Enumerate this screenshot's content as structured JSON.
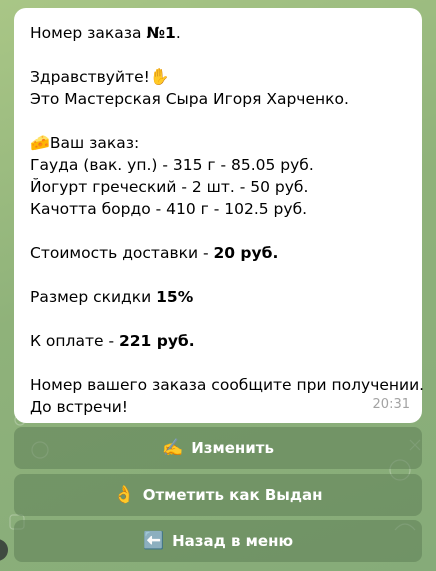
{
  "message": {
    "order_prefix": "Номер заказа ",
    "order_number": "№1",
    "order_suffix": ".",
    "greeting": "Здравствуйте!",
    "greeting_icon": "raised-hand",
    "intro": "Это Мастерская Сыра Игоря Харченко.",
    "order_header_icon": "cheese",
    "order_header": "Ваш заказ:",
    "items": [
      "Гауда (вак. уп.) - 315 г - 85.05 руб.",
      "Йогурт греческий - 2 шт. - 50 руб.",
      "Качотта бордо - 410 г - 102.5 руб."
    ],
    "delivery_label": "Стоимость доставки - ",
    "delivery_value": "20 руб.",
    "discount_label": "Размер скидки ",
    "discount_value": "15%",
    "total_label": "К оплате - ",
    "total_value": "221 руб.",
    "footer_line1": "Номер вашего заказа сообщите при получении.",
    "footer_line2": "До встречи!",
    "time": "20:31"
  },
  "keyboard": {
    "buttons": [
      {
        "icon": "writing-hand",
        "label": "Изменить"
      },
      {
        "icon": "ok-hand",
        "label": "Отметить как Выдан"
      },
      {
        "icon": "left-arrow",
        "label": "Назад в меню"
      }
    ]
  }
}
